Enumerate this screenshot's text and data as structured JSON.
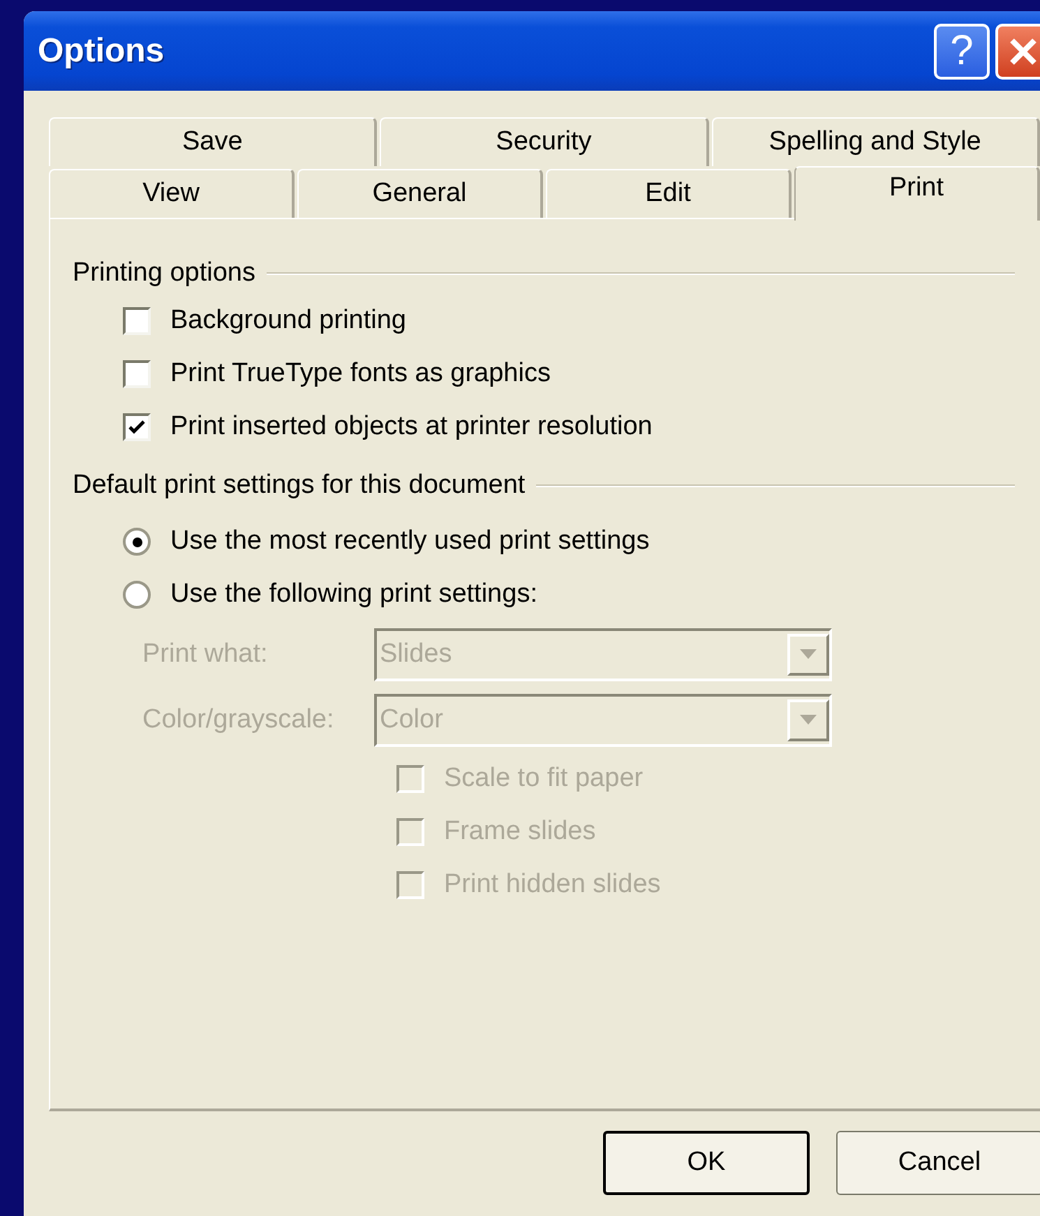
{
  "window": {
    "title": "Options",
    "help_button": "?"
  },
  "tab_rows": [
    {
      "tabs": [
        {
          "label": "Save",
          "selected": false
        },
        {
          "label": "Security",
          "selected": false
        },
        {
          "label": "Spelling and Style",
          "selected": false
        }
      ]
    },
    {
      "tabs": [
        {
          "label": "View",
          "selected": false
        },
        {
          "label": "General",
          "selected": false
        },
        {
          "label": "Edit",
          "selected": false
        },
        {
          "label": "Print",
          "selected": true
        }
      ]
    }
  ],
  "printing_options": {
    "title": "Printing options",
    "items": [
      {
        "label": "Background printing",
        "checked": false,
        "disabled": false
      },
      {
        "label": "Print TrueType fonts as graphics",
        "checked": false,
        "disabled": false
      },
      {
        "label": "Print inserted objects at printer resolution",
        "checked": true,
        "disabled": false
      }
    ]
  },
  "default_print_settings": {
    "title": "Default print settings for this document",
    "radios": [
      {
        "label": "Use the most recently used print settings",
        "selected": true
      },
      {
        "label": "Use the following print settings:",
        "selected": false
      }
    ],
    "dropdowns": [
      {
        "label": "Print what:",
        "value": "Slides",
        "disabled": true
      },
      {
        "label": "Color/grayscale:",
        "value": "Color",
        "disabled": true
      }
    ],
    "items": [
      {
        "label": "Scale to fit paper",
        "checked": false,
        "disabled": true
      },
      {
        "label": "Frame slides",
        "checked": false,
        "disabled": true
      },
      {
        "label": "Print hidden slides",
        "checked": false,
        "disabled": true
      }
    ]
  },
  "buttons": [
    {
      "label": "OK",
      "default": true
    },
    {
      "label": "Cancel",
      "default": false
    }
  ]
}
